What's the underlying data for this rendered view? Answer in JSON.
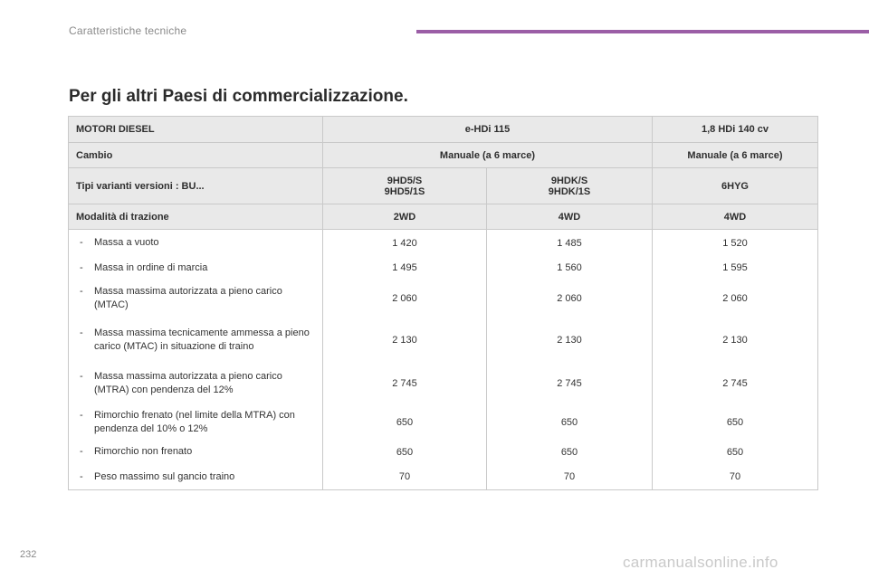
{
  "header": {
    "section_title": "Caratteristiche tecniche",
    "accent_color": "#9b5ea6"
  },
  "page_heading": "Per gli altri Paesi di commercializzazione.",
  "table": {
    "engine_row": {
      "label": "MOTORI DIESEL",
      "engine_1": "e-HDi 115",
      "engine_2": "1,8 HDi 140 cv"
    },
    "gearbox_row": {
      "label": "Cambio",
      "gearbox_1": "Manuale (a 6 marce)",
      "gearbox_2": "Manuale (a 6 marce)"
    },
    "variants_row": {
      "label": "Tipi varianti versioni : BU...",
      "col1": [
        "9HD5/S",
        "9HD5/1S"
      ],
      "col2": [
        "9HDK/S",
        "9HDK/1S"
      ],
      "col3": "6HYG"
    },
    "traction_row": {
      "label": "Modalità di trazione",
      "values": [
        "2WD",
        "4WD",
        "4WD"
      ]
    },
    "data_rows": [
      {
        "dash": "-",
        "label": "Massa a vuoto",
        "values": [
          "1 420",
          "1 485",
          "1 520"
        ]
      },
      {
        "dash": "-",
        "label": "Massa in ordine di marcia",
        "values": [
          "1 495",
          "1 560",
          "1 595"
        ]
      },
      {
        "dash": "-",
        "label": "Massa massima autorizzata a pieno carico (MTAC)",
        "values": [
          "2 060",
          "2 060",
          "2 060"
        ]
      },
      {
        "dash": "-",
        "label": "Massa massima tecnicamente ammessa a pieno carico (MTAC) in situazione di traino",
        "values": [
          "2 130",
          "2 130",
          "2 130"
        ]
      },
      {
        "dash": "-",
        "label": "Massa massima autorizzata a pieno carico (MTRA) con pendenza del 12%",
        "values": [
          "2 745",
          "2 745",
          "2 745"
        ]
      },
      {
        "dash": "-",
        "label": "Rimorchio frenato (nel limite della MTRA) con pendenza del 10% o 12%",
        "values": [
          "650",
          "650",
          "650"
        ]
      },
      {
        "dash": "-",
        "label": "Rimorchio non frenato",
        "values": [
          "650",
          "650",
          "650"
        ]
      },
      {
        "dash": "-",
        "label": "Peso massimo sul gancio traino",
        "values": [
          "70",
          "70",
          "70"
        ]
      }
    ]
  },
  "footer": {
    "page_number": "232",
    "watermark": "carmanualsonline.info"
  }
}
